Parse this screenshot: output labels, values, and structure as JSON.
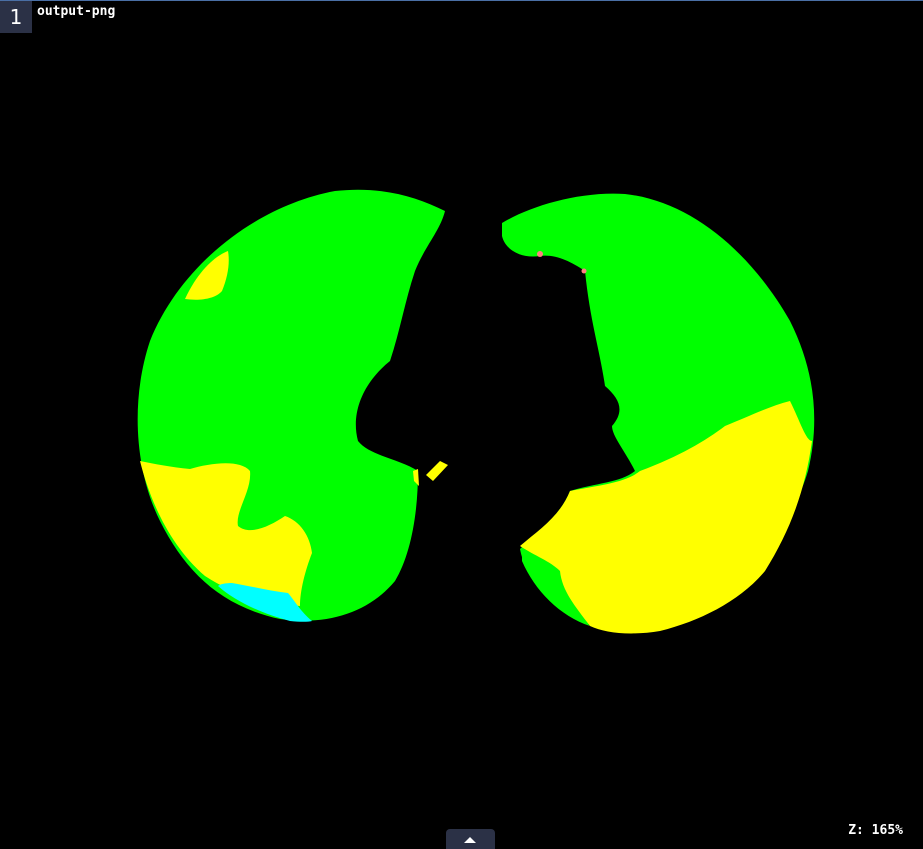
{
  "viewport": {
    "index": "1",
    "label": "output-png",
    "zoom": "Z: 165%"
  },
  "segmentation_colors": {
    "healthy": "#00ff00",
    "affected": "#ffff00",
    "cyan_region": "#00ffff",
    "small_pink_region": "#ff8080",
    "background": "#000000"
  },
  "expand_toggle": {
    "icon": "chevron-up-icon"
  }
}
